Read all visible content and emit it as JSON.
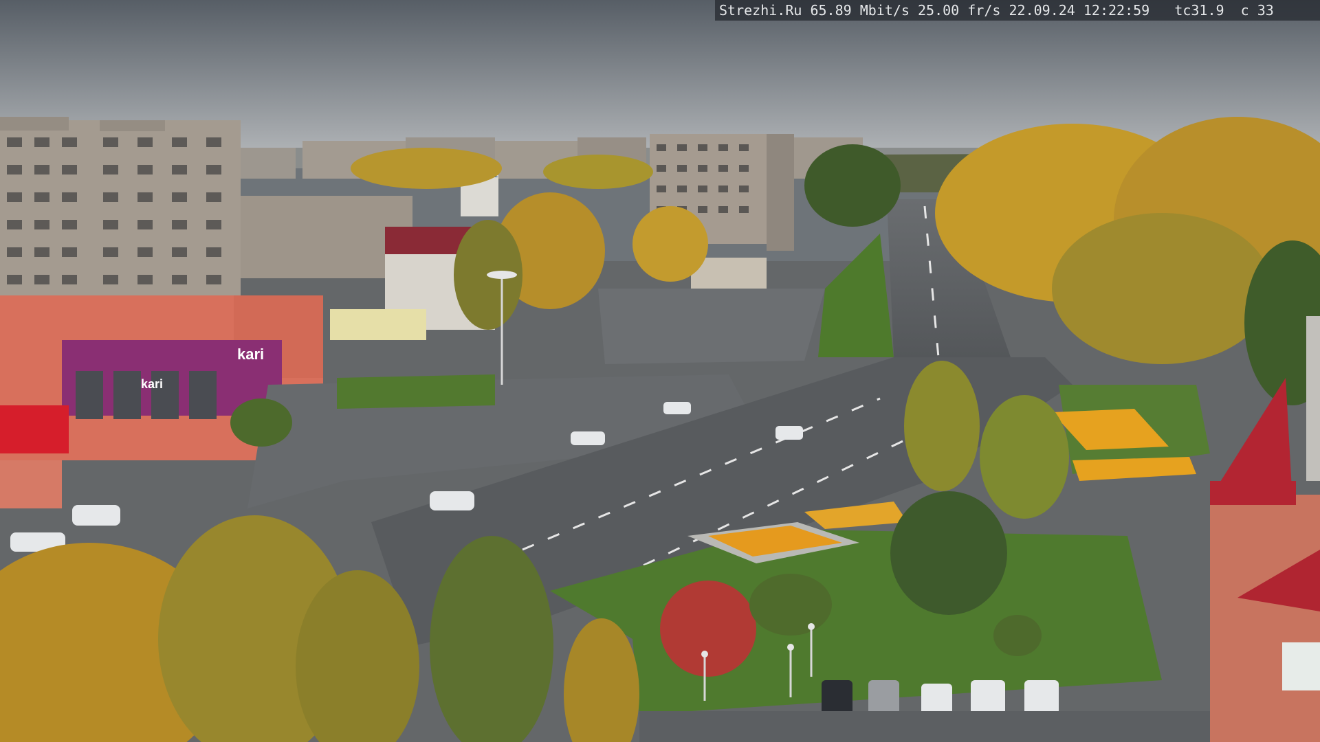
{
  "osd": {
    "site": "Strezhi.Ru",
    "bitrate": "65.89 Mbit/s",
    "framerate": "25.00 fr/s",
    "date": "22.09.24",
    "time": "12:22:59",
    "tc": "tc31.9",
    "c": "c 33"
  },
  "signs": {
    "store_sign": "kari",
    "store_sign_facade": "kari"
  },
  "palette": {
    "sky_top": "#5d646c",
    "sky_horizon": "#a9adb1",
    "asphalt": "#5a5d60",
    "grass": "#4f7a2e",
    "foliage_yellow": "#c49a2a",
    "foliage_green": "#4c6a2a",
    "building_panel": "#a79e93",
    "store_facade": "#d9705a",
    "store_banner": "#8a2f73",
    "roof_red": "#b32532",
    "flowerbed": "#e59a1e"
  }
}
